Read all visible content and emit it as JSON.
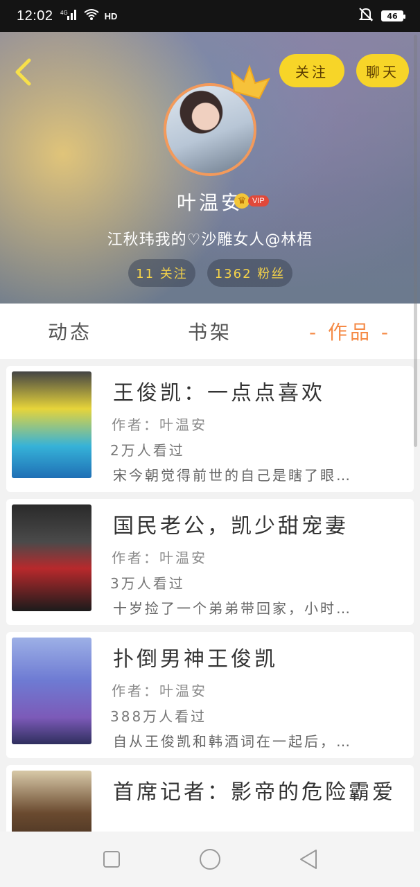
{
  "status_bar": {
    "time": "12:02",
    "network": "4G",
    "hd": "HD",
    "battery": "46"
  },
  "header": {
    "follow_label": "关注",
    "chat_label": "聊天",
    "username": "叶温安",
    "vip_label": "VIP",
    "bio": "江秋玮我的♡沙雕女人@林梧",
    "following_stat": "11 关注",
    "fans_stat": "1362 粉丝"
  },
  "tabs": [
    {
      "label": "动态"
    },
    {
      "label": "书架"
    },
    {
      "label": "- 作品 -"
    }
  ],
  "works": [
    {
      "title": "王俊凯：一点点喜欢",
      "author": "作者：叶温安",
      "views": "2万人看过",
      "desc": "宋今朝觉得前世的自己是瞎了眼…"
    },
    {
      "title": "国民老公，凯少甜宠妻",
      "author": "作者：叶温安",
      "views": "3万人看过",
      "desc": "十岁捡了一个弟弟带回家，小时…"
    },
    {
      "title": "扑倒男神王俊凯",
      "author": "作者：叶温安",
      "views": "388万人看过",
      "desc": "自从王俊凯和韩酒词在一起后，…"
    },
    {
      "title": "首席记者：影帝的危险霸爱",
      "author": "",
      "views": "",
      "desc": ""
    }
  ],
  "colors": {
    "accent": "#f58a46",
    "button_yellow": "#f7d528",
    "avatar_border": "#f39a5b"
  }
}
